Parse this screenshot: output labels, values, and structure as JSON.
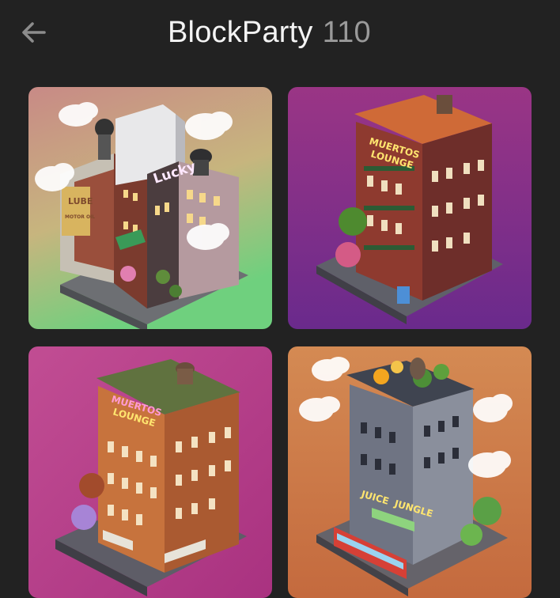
{
  "header": {
    "title": "BlockParty",
    "count": "110",
    "back_icon": "arrow-left-icon"
  },
  "colors": {
    "background": "#222222",
    "title": "#f4f4f4",
    "count": "#9a9a9a"
  },
  "gallery": {
    "items": [
      {
        "icon": "building-artwork",
        "sign": "Lucky",
        "wall_text_1": "LUBE",
        "wall_text_2": "MOTOR OIL",
        "background": "#c98d86"
      },
      {
        "icon": "building-artwork",
        "sign_1": "MUERTOS",
        "sign_2": "LOUNGE",
        "background": "#8c2f8b"
      },
      {
        "icon": "building-artwork",
        "sign_1": "MUERTOS",
        "sign_2": "LOUNGE",
        "background": "#b23e8e"
      },
      {
        "icon": "building-artwork",
        "sign_1": "JUICE",
        "sign_2": "JUNGLE",
        "background": "#d78752"
      }
    ]
  }
}
